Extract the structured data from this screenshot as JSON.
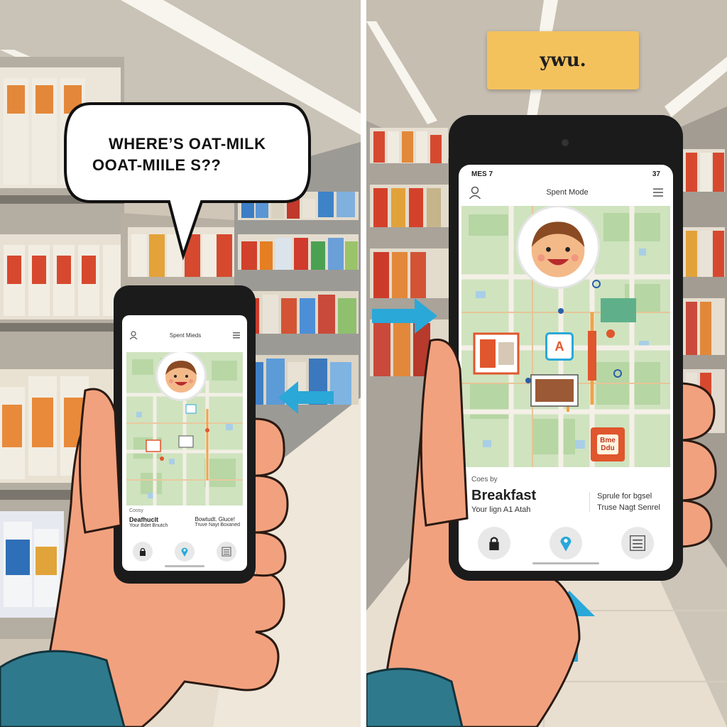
{
  "left_panel": {
    "speech_bubble": {
      "line1": "WHERE’S OAT-MILK",
      "line2": "OOAT-MIILE S??"
    },
    "phone": {
      "status_left": "",
      "status_right": "",
      "app_title": "Spent Mieds",
      "info_label": "Coosy",
      "info_left_title": "Deafhuclt",
      "info_left_sub": "Your Bdet Bnutch",
      "info_right_title": "Bowtudt. Gluce!",
      "info_right_sub": "Truve Nayt Boxaned"
    }
  },
  "right_panel": {
    "sign_text": "ywu.",
    "phone": {
      "status_left": "MES 7",
      "status_right": "37",
      "app_title": "Spent Mode",
      "map_marker_a": "A",
      "map_product_label": "Bme\nDdu",
      "info_label": "Coes by",
      "info_title": "Breakfast",
      "info_sub": "Your lign A1 Atah",
      "info_right_line1": "Sprule for bgsel",
      "info_right_line2": "Truse Nagt Senrel"
    }
  },
  "icons": [
    "user-icon",
    "menu-icon",
    "lock-icon",
    "location-pin-icon",
    "list-icon",
    "arrow-icon"
  ],
  "colors": {
    "accent_blue": "#2aa8d8",
    "map_green": "#cfe3bf",
    "road": "#f3efe6",
    "sign_yellow": "#f4c25d",
    "skin": "#f2a17e",
    "product_red": "#e0562d"
  }
}
